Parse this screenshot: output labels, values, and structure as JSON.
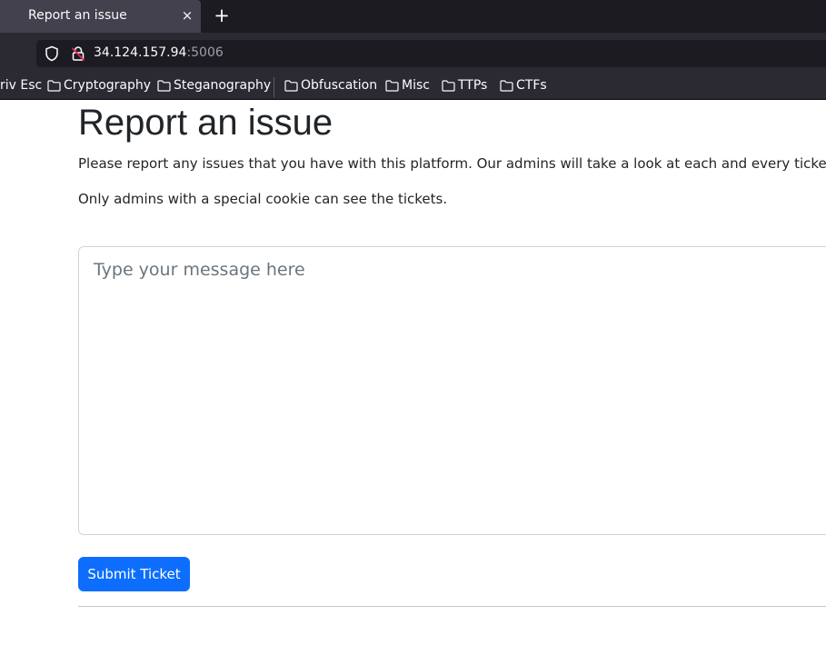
{
  "browser": {
    "tab": {
      "title": "Report an issue",
      "close_glyph": "×",
      "close_icon": "close-icon"
    },
    "new_tab_glyph": "+",
    "url": {
      "host": "34.124.157.94",
      "port": ":5006"
    },
    "icons": {
      "shield": "shield-icon",
      "lock": "lock-insecure-icon",
      "folder": "folder-icon"
    },
    "bookmarks": [
      {
        "label": "riv Esc"
      },
      {
        "label": "Cryptography"
      },
      {
        "label": "Steganography"
      },
      {
        "label": "Obfuscation"
      },
      {
        "label": "Misc"
      },
      {
        "label": "TTPs"
      },
      {
        "label": "CTFs"
      }
    ]
  },
  "page": {
    "title": "Report an issue",
    "intro": "Please report any issues that you have with this platform. Our admins will take a look at each and every ticket.",
    "note": "Only admins with a special cookie can see the tickets.",
    "message_placeholder": "Type your message here",
    "message_value": "",
    "submit_label": "Submit Ticket"
  },
  "colors": {
    "primary_button": "#0d6efd",
    "chrome_dark": "#1c1b22",
    "chrome": "#2b2a33",
    "text": "#212529"
  }
}
